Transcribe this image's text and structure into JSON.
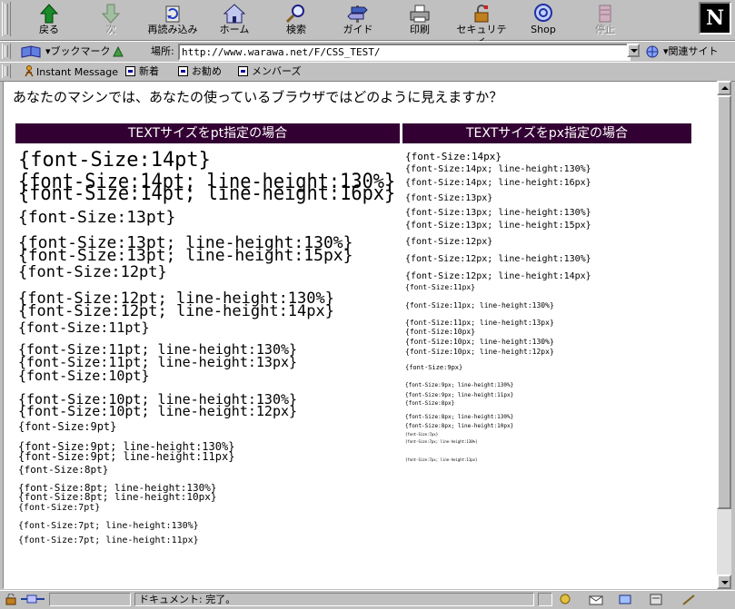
{
  "toolbar": {
    "buttons": [
      {
        "label": "戻る",
        "icon": "back-arrow-icon",
        "enabled": true
      },
      {
        "label": "次",
        "icon": "forward-arrow-icon",
        "enabled": false
      },
      {
        "label": "再読み込み",
        "icon": "reload-icon",
        "enabled": true
      },
      {
        "label": "ホーム",
        "icon": "home-icon",
        "enabled": true
      },
      {
        "label": "検索",
        "icon": "search-icon",
        "enabled": true
      },
      {
        "label": "ガイド",
        "icon": "guide-icon",
        "enabled": true
      },
      {
        "label": "印刷",
        "icon": "print-icon",
        "enabled": true
      },
      {
        "label": "セキュリティ",
        "icon": "security-lock-icon",
        "enabled": true
      },
      {
        "label": "Shop",
        "icon": "shop-icon",
        "enabled": true
      },
      {
        "label": "停止",
        "icon": "stop-icon",
        "enabled": false
      }
    ],
    "logo_letter": "N"
  },
  "location": {
    "bookmarks_label": "ブックマーク",
    "location_label": "場所:",
    "url": "http://www.warawa.net/F/CSS_TEST/",
    "related_label": "関連サイト"
  },
  "personal_bar": {
    "items": [
      "Instant Message",
      "新着",
      "お勧め",
      "メンバーズ"
    ]
  },
  "page": {
    "question": "あなたのマシンでは、あなたの使っているブラウザではどのように見えますか？",
    "pt_header": "TEXTサイズをpt指定の場合",
    "px_header": "TEXTサイズをpx指定の場合",
    "pt_samples": [
      "{font-Size:14pt}",
      "{font-Size:14pt; line-height:130%}",
      "{font-Size:14pt; line-height:16px}",
      "{font-Size:13pt}",
      "{font-Size:13pt; line-height:130%}",
      "{font-Size:13pt; line-height:15px}",
      "{font-Size:12pt}",
      "{font-Size:12pt; line-height:130%}",
      "{font-Size:12pt; line-height:14px}",
      "{font-Size:11pt}",
      "{font-Size:11pt; line-height:130%}",
      "{font-Size:11pt; line-height:13px}",
      "{font-Size:10pt}",
      "{font-Size:10pt; line-height:130%}",
      "{font-Size:10pt; line-height:12px}",
      "{font-Size:9pt}",
      "{font-Size:9pt; line-height:130%}",
      "{font-Size:9pt; line-height:11px}",
      "{font-Size:8pt}",
      "{font-Size:8pt; line-height:130%}",
      "{font-Size:8pt; line-height:10px}",
      "{font-Size:7pt}",
      "{font-Size:7pt; line-height:130%}",
      "{font-Size:7pt; line-height:11px}"
    ],
    "px_samples": [
      "{font-Size:14px}",
      "{font-Size:14px; line-height:130%}",
      "{font-Size:14px; line-height:16px}",
      "{font-Size:13px}",
      "{font-Size:13px; line-height:130%}",
      "{font-Size:13px; line-height:15px}",
      "{font-Size:12px}",
      "{font-Size:12px; line-height:130%}",
      "{font-Size:12px; line-height:14px}",
      "{font-Size:11px}",
      "{font-Size:11px; line-height:130%}",
      "{font-Size:11px; line-height:13px}",
      "{font-Size:10px}",
      "{font-Size:10px; line-height:130%}",
      "{font-Size:10px; line-height:12px}",
      "{font-Size:9px}",
      "{font-Size:9px; line-height:130%}",
      "{font-Size:9px; line-height:11px}",
      "{font-Size:8px}",
      "{font-Size:8px; line-height:130%}",
      "{font-Size:8px; line-height:10px}",
      "{font-Size:7px}",
      "{font-Size:7px; line-height:130%}",
      "{font-Size:7px; line-height:11px}"
    ]
  },
  "status": {
    "text": "ドキュメント: 完了。"
  },
  "colors": {
    "header_bg": "#330033",
    "chrome": "#c0c0c0"
  }
}
